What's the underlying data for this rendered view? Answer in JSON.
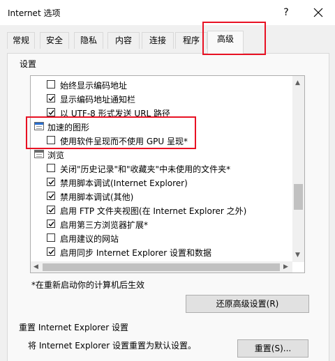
{
  "window": {
    "title": "Internet 选项",
    "help": "?",
    "close_icon": "close-icon"
  },
  "tabs": [
    {
      "label": "常规"
    },
    {
      "label": "安全"
    },
    {
      "label": "隐私"
    },
    {
      "label": "内容"
    },
    {
      "label": "连接"
    },
    {
      "label": "程序"
    },
    {
      "label": "高级",
      "active": true
    }
  ],
  "settings": {
    "group_label": "设置",
    "items": [
      {
        "type": "checkbox",
        "checked": false,
        "label": "始终显示编码地址"
      },
      {
        "type": "checkbox",
        "checked": true,
        "label": "显示编码地址通知栏"
      },
      {
        "type": "checkbox",
        "checked": true,
        "label": "以 UTF-8 形式发送 URL 路径"
      },
      {
        "type": "category",
        "icon": "accelerated-graphics-icon",
        "label": "加速的图形"
      },
      {
        "type": "checkbox",
        "checked": false,
        "label": "使用软件呈现而不使用 GPU 呈现*"
      },
      {
        "type": "category",
        "icon": "browsing-icon",
        "label": "浏览"
      },
      {
        "type": "checkbox",
        "checked": false,
        "label": "关闭\"历史记录\"和\"收藏夹\"中未使用的文件夹*"
      },
      {
        "type": "checkbox",
        "checked": true,
        "label": "禁用脚本调试(Internet Explorer)"
      },
      {
        "type": "checkbox",
        "checked": true,
        "label": "禁用脚本调试(其他)"
      },
      {
        "type": "checkbox",
        "checked": true,
        "label": "启用 FTP 文件夹视图(在 Internet Explorer 之外)"
      },
      {
        "type": "checkbox",
        "checked": true,
        "label": "启用第三方浏览器扩展*"
      },
      {
        "type": "checkbox",
        "checked": false,
        "label": "启用建议的网站"
      },
      {
        "type": "checkbox",
        "checked": true,
        "label": "启用同步 Internet Explorer 设置和数据"
      }
    ],
    "restart_note": "*在重新启动你的计算机后生效",
    "restore_button": "还原高级设置(R)"
  },
  "reset": {
    "title": "重置 Internet Explorer 设置",
    "description": "将 Internet Explorer 设置重置为默认设置。",
    "button": "重置(S)..."
  },
  "colors": {
    "highlight": "#e81123",
    "accent": "#2a6fcf"
  }
}
